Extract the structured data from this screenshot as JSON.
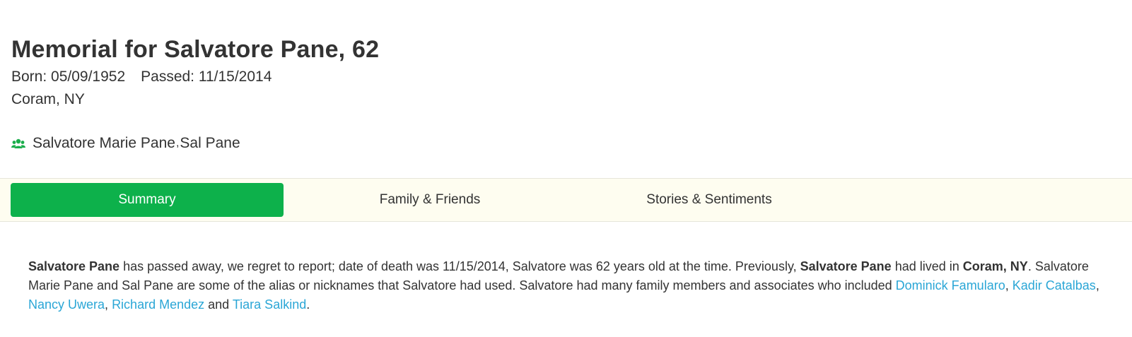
{
  "header": {
    "title": "Memorial for Salvatore Pane, 62",
    "born": "Born: 05/09/1952",
    "passed": "Passed: 11/15/2014",
    "location": "Coram, NY"
  },
  "aliases": {
    "icon": "people-icon",
    "icon_color": "#1aad4b",
    "first": "Salvatore Marie Pane",
    "separator": ",",
    "second": "Sal Pane"
  },
  "tabs": [
    {
      "label": "Summary",
      "active": true
    },
    {
      "label": "Family & Friends",
      "active": false
    },
    {
      "label": "Stories & Sentiments",
      "active": false
    }
  ],
  "summary": {
    "name_bold": "Salvatore Pane",
    "text1": " has passed away, we regret to report; date of death was 11/15/2014, Salvatore was 62 years old at the time. Previously, ",
    "name_bold2": "Salvatore Pane",
    "text2": " had lived in ",
    "location_bold": "Coram, NY",
    "text3": ". Salvatore Marie Pane and Sal Pane are some of the alias or nicknames that Salvatore had used. Salvatore had many family members and associates who included ",
    "links": [
      "Dominick Famularo",
      "Kadir Catalbas",
      "Nancy Uwera",
      "Richard Mendez",
      "Tiara Salkind"
    ],
    "sep": ", ",
    "and": " and ",
    "end": "."
  },
  "colors": {
    "accent": "#0db14b",
    "tabbar_bg": "#fefdf0",
    "link": "#2aa6d6",
    "text": "#333333"
  }
}
